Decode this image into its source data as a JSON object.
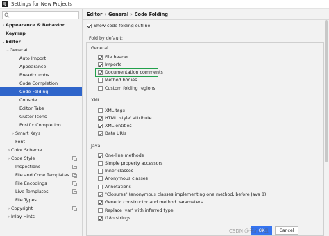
{
  "window": {
    "title": "Settings for New Projects",
    "app_icon_text": "IJ"
  },
  "search": {
    "placeholder": ""
  },
  "sidebar": {
    "items": [
      {
        "label": "Appearance & Behavior",
        "arrow": "›",
        "bold": true
      },
      {
        "label": "Keymap",
        "arrow": "",
        "bold": true
      },
      {
        "label": "Editor",
        "arrow": "⌄",
        "bold": true
      },
      {
        "label": "General",
        "arrow": "⌄"
      },
      {
        "label": "Auto Import",
        "arrow": ""
      },
      {
        "label": "Appearance",
        "arrow": ""
      },
      {
        "label": "Breadcrumbs",
        "arrow": ""
      },
      {
        "label": "Code Completion",
        "arrow": ""
      },
      {
        "label": "Code Folding",
        "arrow": "",
        "selected": true
      },
      {
        "label": "Console",
        "arrow": ""
      },
      {
        "label": "Editor Tabs",
        "arrow": ""
      },
      {
        "label": "Gutter Icons",
        "arrow": ""
      },
      {
        "label": "Postfix Completion",
        "arrow": ""
      },
      {
        "label": "Smart Keys",
        "arrow": "›"
      },
      {
        "label": "Font",
        "arrow": ""
      },
      {
        "label": "Color Scheme",
        "arrow": "›"
      },
      {
        "label": "Code Style",
        "arrow": "›"
      },
      {
        "label": "Inspections",
        "arrow": ""
      },
      {
        "label": "File and Code Templates",
        "arrow": ""
      },
      {
        "label": "File Encodings",
        "arrow": ""
      },
      {
        "label": "Live Templates",
        "arrow": ""
      },
      {
        "label": "File Types",
        "arrow": ""
      },
      {
        "label": "Copyright",
        "arrow": "›"
      },
      {
        "label": "Inlay Hints",
        "arrow": "›"
      }
    ]
  },
  "breadcrumb": {
    "part1": "Editor",
    "sep": "›",
    "part2": "General",
    "part3": "Code Folding"
  },
  "main": {
    "show_outline": {
      "label": "Show code folding outline",
      "checked": true
    },
    "fold_by_default_label": "Fold by default:",
    "general": {
      "label": "General",
      "items": [
        {
          "label": "File header",
          "checked": true
        },
        {
          "label": "Imports",
          "checked": true
        },
        {
          "label": "Documentation comments",
          "checked": true
        },
        {
          "label": "Method bodies",
          "checked": false
        },
        {
          "label": "Custom folding regions",
          "checked": false
        }
      ]
    },
    "xml": {
      "label": "XML",
      "items": [
        {
          "label": "XML tags",
          "checked": false
        },
        {
          "label": "HTML 'style' attribute",
          "checked": true
        },
        {
          "label": "XML entities",
          "checked": true
        },
        {
          "label": "Data URIs",
          "checked": true
        }
      ]
    },
    "java": {
      "label": "Java",
      "items": [
        {
          "label": "One-line methods",
          "checked": true
        },
        {
          "label": "Simple property accessors",
          "checked": false
        },
        {
          "label": "Inner classes",
          "checked": false
        },
        {
          "label": "Anonymous classes",
          "checked": false
        },
        {
          "label": "Annotations",
          "checked": false
        },
        {
          "label": "\"Closures\" (anonymous classes implementing one method, before Java 8)",
          "checked": true
        },
        {
          "label": "Generic constructor and method parameters",
          "checked": true
        },
        {
          "label": "Replace 'var' with inferred type",
          "checked": false
        },
        {
          "label": "I18n strings",
          "checked": true
        }
      ]
    }
  },
  "footer": {
    "ok": "OK",
    "cancel": "Cancel"
  },
  "watermark": "CSDN @无心工具",
  "colors": {
    "selection": "#2f65ca",
    "highlight_box": "#22a04b",
    "ok_button": "#3574f0"
  }
}
